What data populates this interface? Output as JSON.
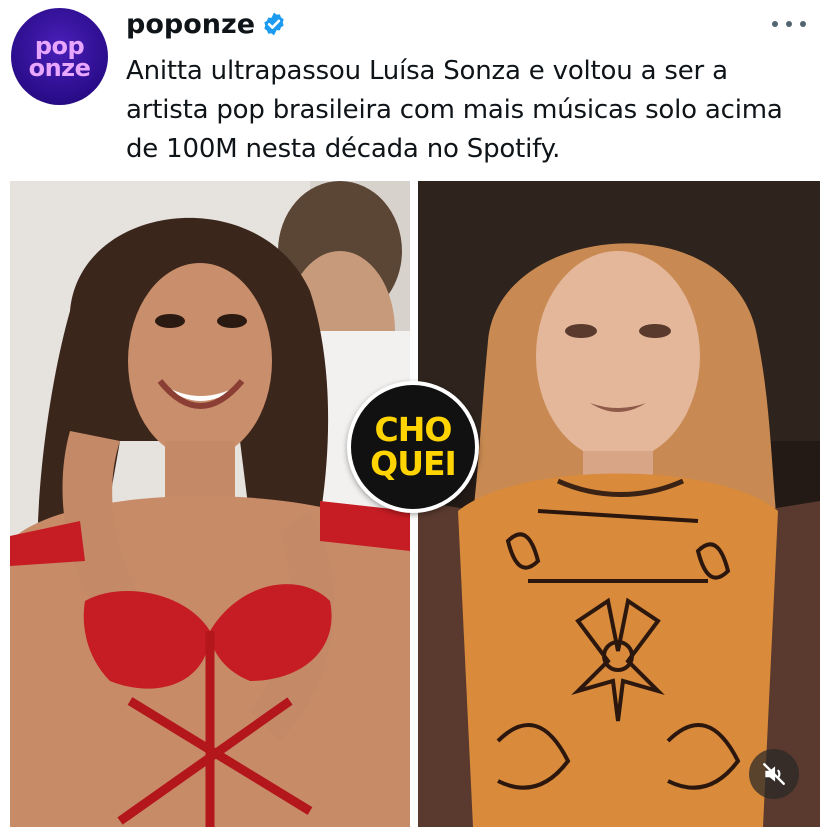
{
  "post": {
    "avatar_lines": [
      "pop",
      "onze"
    ],
    "username": "poponze",
    "verified": true,
    "more_icon": "more-horizontal-icon",
    "text": "Anitta ultrapassou Luísa Sonza e voltou a ser a artista pop brasileira com mais músicas solo acima de 100M nesta década no Spotify."
  },
  "media": {
    "badge_lines": [
      "CHO",
      "QUEI"
    ],
    "badge_color": "#ffd400",
    "mute_icon": "muted-speaker-icon"
  },
  "colors": {
    "verified_blue": "#1d9bf0",
    "avatar_purple": "#2a0c8a",
    "avatar_text": "#e8a6ff"
  }
}
